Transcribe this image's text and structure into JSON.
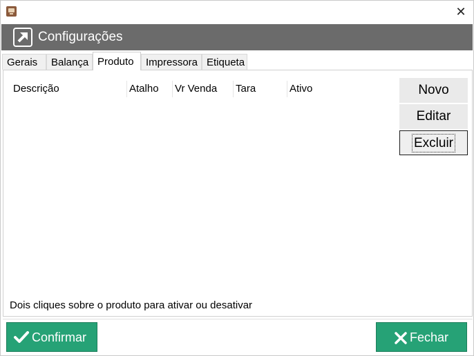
{
  "window": {
    "close_glyph": "✕"
  },
  "header": {
    "title": "Configurações",
    "logo_icon": "arrow-up-right-icon"
  },
  "tabs": [
    {
      "label": "Gerais",
      "active": false
    },
    {
      "label": "Balança",
      "active": false
    },
    {
      "label": "Produto",
      "active": true
    },
    {
      "label": "Impressora",
      "active": false
    },
    {
      "label": "Etiqueta",
      "active": false
    }
  ],
  "product_list": {
    "columns": [
      "Descrição",
      "Atalho",
      "Vr Venda",
      "Tara",
      "Ativo"
    ],
    "rows": []
  },
  "side_buttons": {
    "novo": "Novo",
    "editar": "Editar",
    "excluir": "Excluir"
  },
  "hint": "Dois cliques sobre o produto para ativar ou desativar",
  "actions": {
    "confirmar": "Confirmar",
    "fechar": "Fechar"
  },
  "colors": {
    "header_bg": "#6b6b6b",
    "action_green": "#26a276"
  }
}
